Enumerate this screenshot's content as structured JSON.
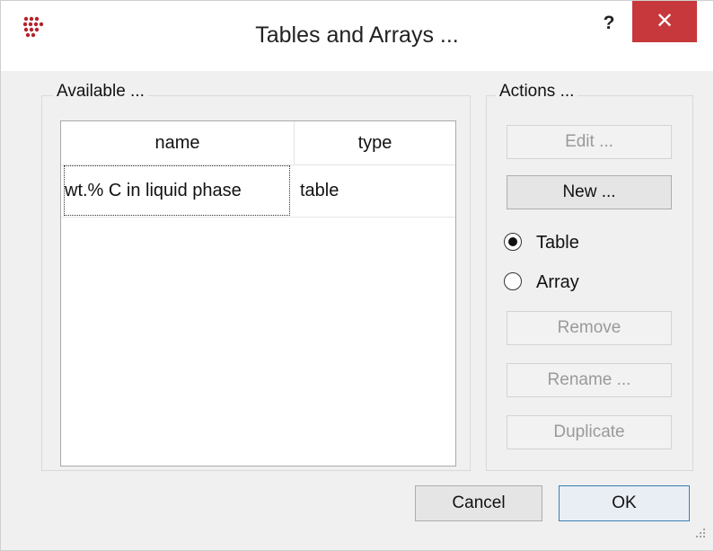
{
  "window": {
    "title": "Tables and Arrays ...",
    "help_label": "?",
    "close_label": "✕",
    "accent_close": "#c7383c"
  },
  "available": {
    "group_title": "Available ...",
    "columns": [
      "name",
      "type"
    ],
    "rows": [
      {
        "name": "wt.% C in liquid phase",
        "type": "table"
      }
    ]
  },
  "actions": {
    "group_title": "Actions ...",
    "edit_label": "Edit ...",
    "new_label": "New ...",
    "radio_table_label": "Table",
    "radio_array_label": "Array",
    "selected_type": "Table",
    "remove_label": "Remove",
    "rename_label": "Rename ...",
    "duplicate_label": "Duplicate"
  },
  "footer": {
    "cancel_label": "Cancel",
    "ok_label": "OK"
  }
}
